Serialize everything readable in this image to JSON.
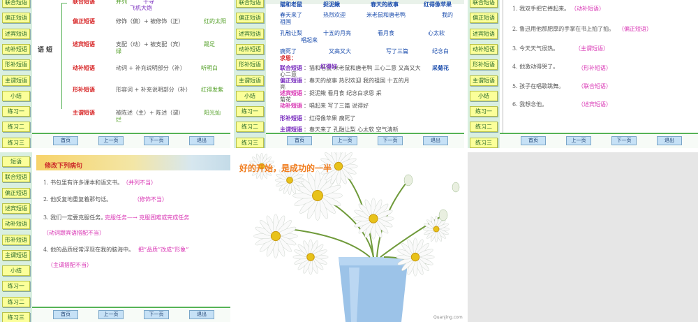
{
  "sidebar_items": [
    "联合短语",
    "偏正短语",
    "述宾短语",
    "动补短语",
    "形补短语",
    "主谓短语",
    "小结",
    "练习一",
    "练习二",
    "练习三"
  ],
  "sidebar_items4": [
    "短语",
    "联合短语",
    "偏正短语",
    "述宾短语",
    "动补短语",
    "形补短语",
    "主谓短语",
    "小结",
    "练习一",
    "练习二",
    "练习三"
  ],
  "nav": {
    "home": "首页",
    "prev": "上一页",
    "next": "下一页",
    "exit": "退出"
  },
  "panel1": {
    "side_title": "语 短",
    "r0": {
      "name": "联合短语",
      "formula": "并列",
      "example": "千寻",
      "extra": "飞机大炮"
    },
    "r1": {
      "name": "偏正短语",
      "formula": "修饰（偏）+ 被修饰（正）",
      "example": "红的太阳"
    },
    "r2": {
      "name": "述宾短语",
      "formula": "支配（动）+ 被支配（宾）",
      "formula2": "绿",
      "example": "踢足"
    },
    "r3": {
      "name": "动补短语",
      "formula": "动词 + 补充说明部分（补）",
      "example": "听明白"
    },
    "r4": {
      "name": "形补短语",
      "formula": "形容词 + 补充说明部分（补）",
      "example": "红得发紫"
    },
    "r5": {
      "name": "主谓短语",
      "formula": "被陈述（主）+ 陈述（谓）",
      "formula2": "烂",
      "example": "阳光灿"
    }
  },
  "panel2": {
    "l1": [
      "猫和老鼠",
      "捉泥鳅",
      "春天的故事",
      "红得像苹果"
    ],
    "l2": [
      "春天来了",
      "热烈欢迎",
      "米老鼠和唐老鸭",
      "我的"
    ],
    "l2b": "祖国",
    "l3": [
      "孔融让梨",
      "十五的月亮",
      "看月食",
      "心太软"
    ],
    "l3b": "唱起来",
    "l4": [
      "瘸死了",
      "又高又大",
      "写了三篇",
      "纪念白"
    ],
    "l4b": "求恩：",
    "ans_join_label": "联合短语",
    "ans_join": "：猫和老鼠 米老鼠和唐老鸭  三心二意  又高又大",
    "ans_join_mark": "采菊花",
    "ans_join_tail": "心二意",
    "ans_join_over": "红得好",
    "ans_pz_label": "偏正短语",
    "ans_pz": "：春天的故事      热烈欢迎        我的祖国        十五的月",
    "ans_pz_tail": "亮",
    "ans_sb_label": "述宾短语",
    "ans_sb": "：捉泥鳅      看月食       纪念白求恩          采",
    "ans_sb_tail": "菊花",
    "ans_db_label": "动补短语",
    "ans_db": "：唱起来      写了三篇        说得好",
    "ans_xb_label": "形补短语",
    "ans_xb": "：红得像苹果                瘸死了",
    "ans_zw_label": "主谓短语",
    "ans_zw": "：春天来了     孔融让梨       心太软           空气清新"
  },
  "panel3": {
    "items": [
      {
        "q": "1. 我双手把它捧起来。",
        "a": "（动补短语）"
      },
      {
        "q": "2. 鲁迅用他那肥厚的手掌在书上拍了拍。",
        "a": "（偏正短语）"
      },
      {
        "q": "3. 今天天气很热。",
        "a": "（主谓短语）"
      },
      {
        "q": "4. 他激动得哭了。",
        "a": "（形补短语）"
      },
      {
        "q": "5. 孩子在唱歌跳舞。",
        "a": "（联合短语）"
      },
      {
        "q": "6. 我想念他。",
        "a": "（述宾短语）"
      }
    ]
  },
  "panel4": {
    "title": "修改下列病句",
    "q1": "1. 书包里有许多课本和语文书。",
    "a1": "（并列不当）",
    "q2": "2. 他反复地重复着那句话。",
    "a2": "（修饰不当）",
    "q3": "3. 我们一定要克服任务。",
    "q3fix": "克服任务—→ 克服困难或完成任务",
    "a3": "（动词跟宾语搭配不当）",
    "q4": "4. 他的品质经常浮现在我的脑海中。",
    "q4fix": "把“品质”改成“形象”",
    "a4": "（主谓搭配不当）"
  },
  "panel5": {
    "slogan": "好的开始，是成功的一半",
    "watermark": "Quanjing.com"
  }
}
